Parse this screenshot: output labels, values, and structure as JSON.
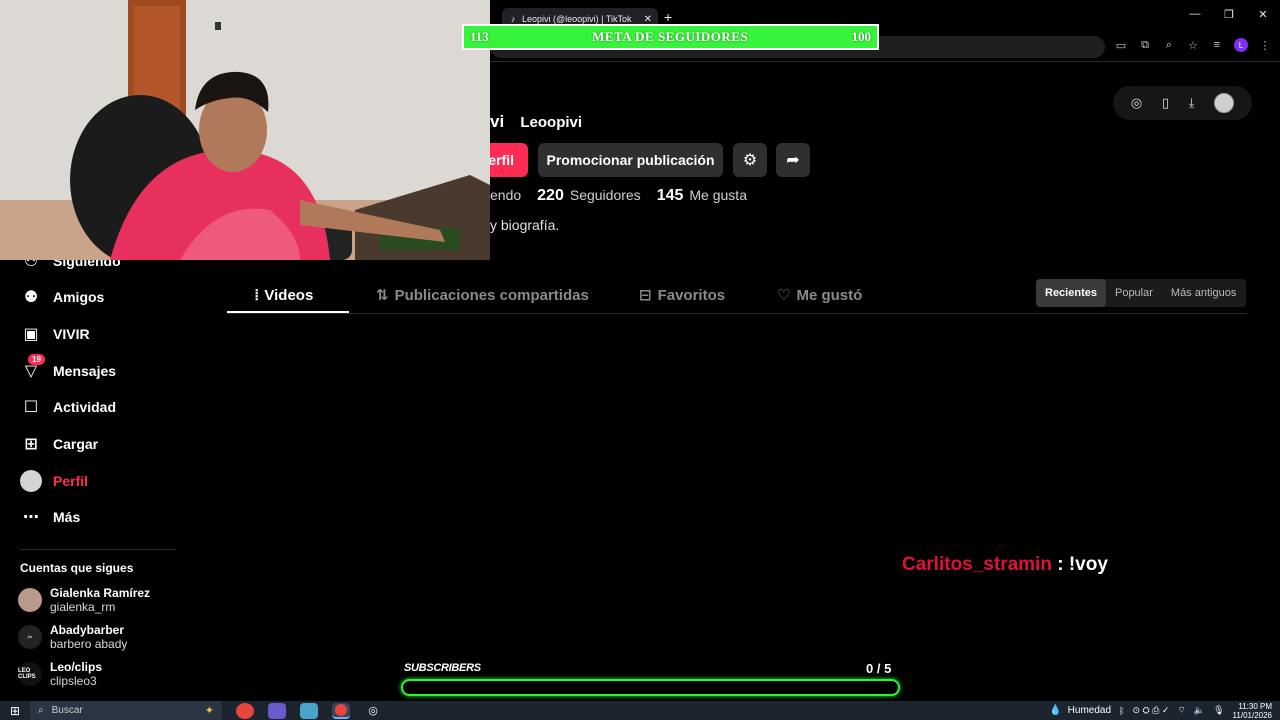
{
  "browser": {
    "tab_title": "Leopivi (@leoopivi) | TikTok",
    "tab_close": "✕",
    "new_tab": "+",
    "window_controls": [
      "—",
      "❐",
      "✕"
    ]
  },
  "goal_bar": {
    "left_value": "113",
    "title": "META DE SEGUIDORES",
    "right_value": "100"
  },
  "profile": {
    "name_fragment": "vi",
    "username": "Leoopivi",
    "edit_button": "erfil",
    "promote_button": "Promocionar publicación",
    "stats": {
      "following_label_fragment": "endo",
      "followers_count": "220",
      "followers_label": "Seguidores",
      "likes_count": "145",
      "likes_label": "Me gusta"
    },
    "bio": "y biografía."
  },
  "tabs": [
    {
      "label": "Videos",
      "icon": "grid-icon",
      "active": true
    },
    {
      "label": "Publicaciones compartidas",
      "icon": "repost-icon",
      "active": false
    },
    {
      "label": "Favoritos",
      "icon": "bookmark-icon",
      "active": false
    },
    {
      "label": "Me gustó",
      "icon": "heart-icon",
      "active": false
    }
  ],
  "sort_options": [
    {
      "label": "Recientes",
      "active": true
    },
    {
      "label": "Popular",
      "active": false
    },
    {
      "label": "Más antiguos",
      "active": false
    }
  ],
  "sidebar": {
    "items": [
      {
        "label": "Siguiendo",
        "icon": "following-icon"
      },
      {
        "label": "Amigos",
        "icon": "friends-icon"
      },
      {
        "label": "VIVIR",
        "icon": "live-icon"
      },
      {
        "label": "Mensajes",
        "icon": "messages-icon",
        "badge": "19"
      },
      {
        "label": "Actividad",
        "icon": "activity-icon"
      },
      {
        "label": "Cargar",
        "icon": "upload-icon"
      },
      {
        "label": "Perfil",
        "icon": "profile-avatar-icon",
        "active": true
      },
      {
        "label": "Más",
        "icon": "more-icon"
      }
    ],
    "following_title": "Cuentas que sigues",
    "following": [
      {
        "name": "Gialenka Ramírez",
        "handle": "gialenka_rm"
      },
      {
        "name": "Abadybarber",
        "handle": "barbero abady"
      },
      {
        "name": "Leo/clips",
        "handle": "clipsleo3",
        "pic_text": "LEO CLIPS"
      }
    ]
  },
  "chat": {
    "user": "Carlitos_stramin",
    "message": " : !voy"
  },
  "subscribers": {
    "label": "SUBSCRIBERS",
    "current": "0",
    "goal": "/ 5",
    "progress": 0
  },
  "taskbar": {
    "search_placeholder": "Buscar",
    "weather": "Humedad",
    "time": "11:30 PM",
    "date": "11/01/2026"
  },
  "colors": {
    "accent": "#fe2c55",
    "goal_green": "#38f33c",
    "sub_bar_green": "#2cf03a",
    "chat_user": "#e0103a"
  }
}
